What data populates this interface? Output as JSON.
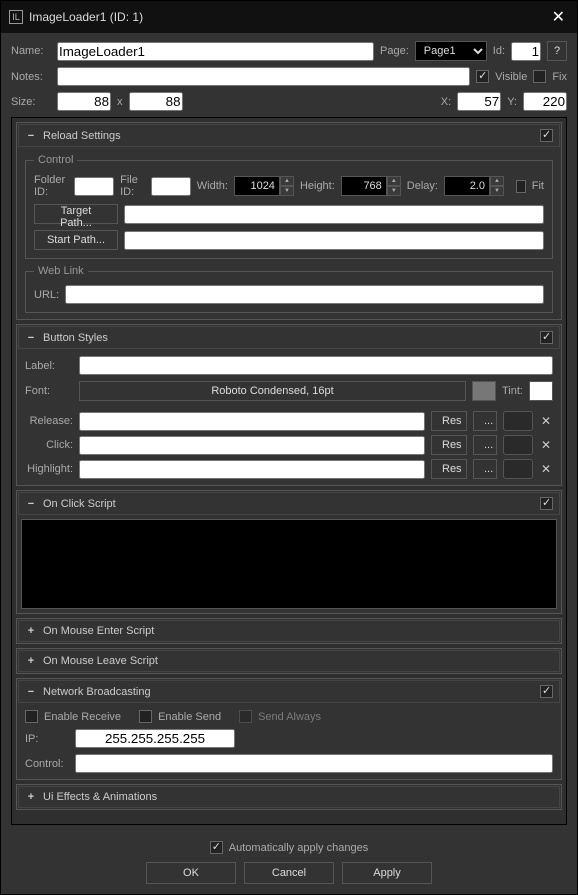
{
  "title": "ImageLoader1 (ID: 1)",
  "header": {
    "name_label": "Name:",
    "name_value": "ImageLoader1",
    "page_label": "Page:",
    "page_value": "Page1",
    "id_label": "Id:",
    "id_value": "1",
    "help": "?",
    "notes_label": "Notes:",
    "notes_value": "",
    "visible_label": "Visible",
    "fix_label": "Fix",
    "size_label": "Size:",
    "size_w": "88",
    "size_x": "x",
    "size_h": "88",
    "x_label": "X:",
    "x_value": "57",
    "y_label": "Y:",
    "y_value": "220"
  },
  "reload": {
    "title": "Reload Settings",
    "control_legend": "Control",
    "folder_id_label": "Folder ID:",
    "folder_id_value": "",
    "file_id_label": "File ID:",
    "file_id_value": "",
    "width_label": "Width:",
    "width_value": "1024",
    "height_label": "Height:",
    "height_value": "768",
    "delay_label": "Delay:",
    "delay_value": "2.0",
    "fit_label": "Fit",
    "target_path_btn": "Target Path...",
    "target_path_value": "",
    "start_path_btn": "Start Path...",
    "start_path_value": "",
    "weblink_legend": "Web Link",
    "url_label": "URL:",
    "url_value": ""
  },
  "button_styles": {
    "title": "Button Styles",
    "label_label": "Label:",
    "label_value": "",
    "font_label": "Font:",
    "font_value": "Roboto Condensed, 16pt",
    "tint_label": "Tint:",
    "rows": [
      {
        "label": "Release:",
        "value": ""
      },
      {
        "label": "Click:",
        "value": ""
      },
      {
        "label": "Highlight:",
        "value": ""
      }
    ],
    "res_btn": "Res",
    "dots_btn": "..."
  },
  "onclick": {
    "title": "On Click Script"
  },
  "onenter": {
    "title": "On Mouse Enter Script"
  },
  "onleave": {
    "title": "On Mouse Leave Script"
  },
  "network": {
    "title": "Network Broadcasting",
    "enable_receive": "Enable Receive",
    "enable_send": "Enable Send",
    "send_always": "Send Always",
    "ip_label": "IP:",
    "ip_value": "255.255.255.255",
    "control_label": "Control:",
    "control_value": ""
  },
  "effects": {
    "title": "Ui Effects & Animations"
  },
  "footer": {
    "auto_apply": "Automatically apply changes",
    "ok": "OK",
    "cancel": "Cancel",
    "apply": "Apply"
  }
}
